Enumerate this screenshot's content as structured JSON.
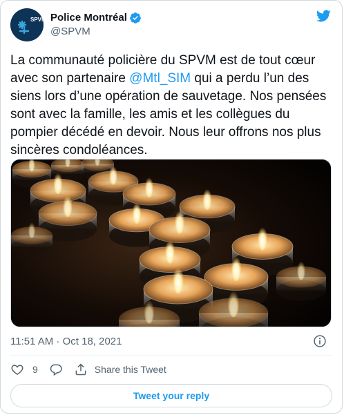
{
  "author": {
    "display_name": "Police Montréal",
    "handle": "@SPVM",
    "avatar_text": "SPVM",
    "verified_icon": "verified-badge-icon"
  },
  "tweet": {
    "text_before": "La communauté policière du SPVM est de tout cœur avec son partenaire ",
    "mention": "@Mtl_SIM",
    "text_after": " qui a perdu l’un des siens lors d’une opération de sauvetage. Nos pensées sont avec la famille, les amis et les collègues du pompier décédé en devoir. Nous leur offrons nos plus sincères condoléances."
  },
  "meta": {
    "timestamp": "11:51 AM · Oct 18, 2021"
  },
  "actions": {
    "like_count": "9",
    "share_label": "Share this Tweet"
  },
  "reply": {
    "button_label": "Tweet your reply"
  },
  "colors": {
    "accent": "#1d9bf0",
    "secondary_text": "#536471",
    "border": "#cfd9de"
  }
}
